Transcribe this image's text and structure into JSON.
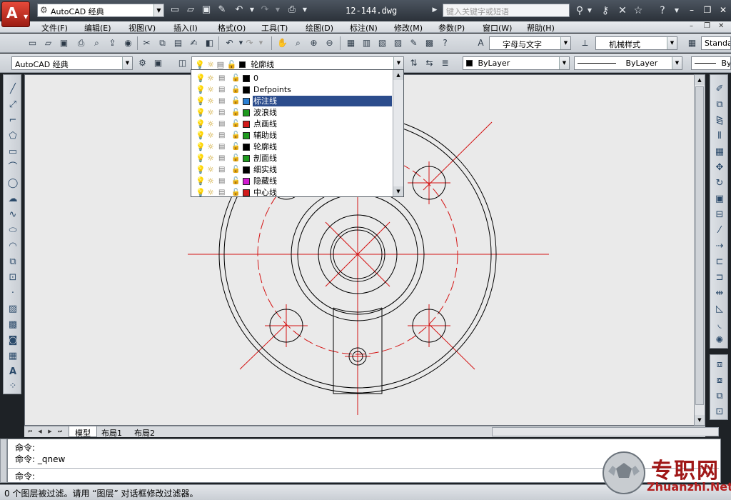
{
  "title_bar": {
    "workspace": "AutoCAD 经典",
    "document_title": "12-144.dwg",
    "search_placeholder": "键入关键字或短语"
  },
  "menu": {
    "items": [
      "文件(F)",
      "编辑(E)",
      "视图(V)",
      "插入(I)",
      "格式(O)",
      "工具(T)",
      "绘图(D)",
      "标注(N)",
      "修改(M)",
      "参数(P)",
      "窗口(W)",
      "帮助(H)"
    ]
  },
  "toolbar": {
    "text_style": "字母与文字",
    "dim_style": "机械样式",
    "table_style": "Standa",
    "workspace_combo": "AutoCAD 经典",
    "current_layer": "轮廓线",
    "color": "ByLayer",
    "linetype": "ByLayer",
    "lineweight": "By"
  },
  "layers": [
    {
      "name": "0",
      "color": "#000000"
    },
    {
      "name": "Defpoints",
      "color": "#000000"
    },
    {
      "name": "标注线",
      "color": "#2a7fd4",
      "selected": true
    },
    {
      "name": "波浪线",
      "color": "#1e9a1e"
    },
    {
      "name": "点画线",
      "color": "#d21a1a"
    },
    {
      "name": "辅助线",
      "color": "#1e9a1e"
    },
    {
      "name": "轮廓线",
      "color": "#000000"
    },
    {
      "name": "剖面线",
      "color": "#1e9a1e"
    },
    {
      "name": "细实线",
      "color": "#000000"
    },
    {
      "name": "隐藏线",
      "color": "#d11ad1"
    },
    {
      "name": "中心线",
      "color": "#d21a1a"
    }
  ],
  "tabs": [
    "模型",
    "布局1",
    "布局2"
  ],
  "command": {
    "line1": "命令:",
    "line2": "命令:  _qnew",
    "prompt": "命令:"
  },
  "status": {
    "text": "0 个图层被过滤。请用 “图层” 对话框修改过滤器。"
  },
  "watermark": {
    "brand": "专职网",
    "url": "Zhuanzhi.Net"
  },
  "colors": {
    "drawing_line": "#000000",
    "center_line": "#d41414",
    "canvas_bg": "#eaeaea",
    "selection": "#2b4c8c"
  }
}
